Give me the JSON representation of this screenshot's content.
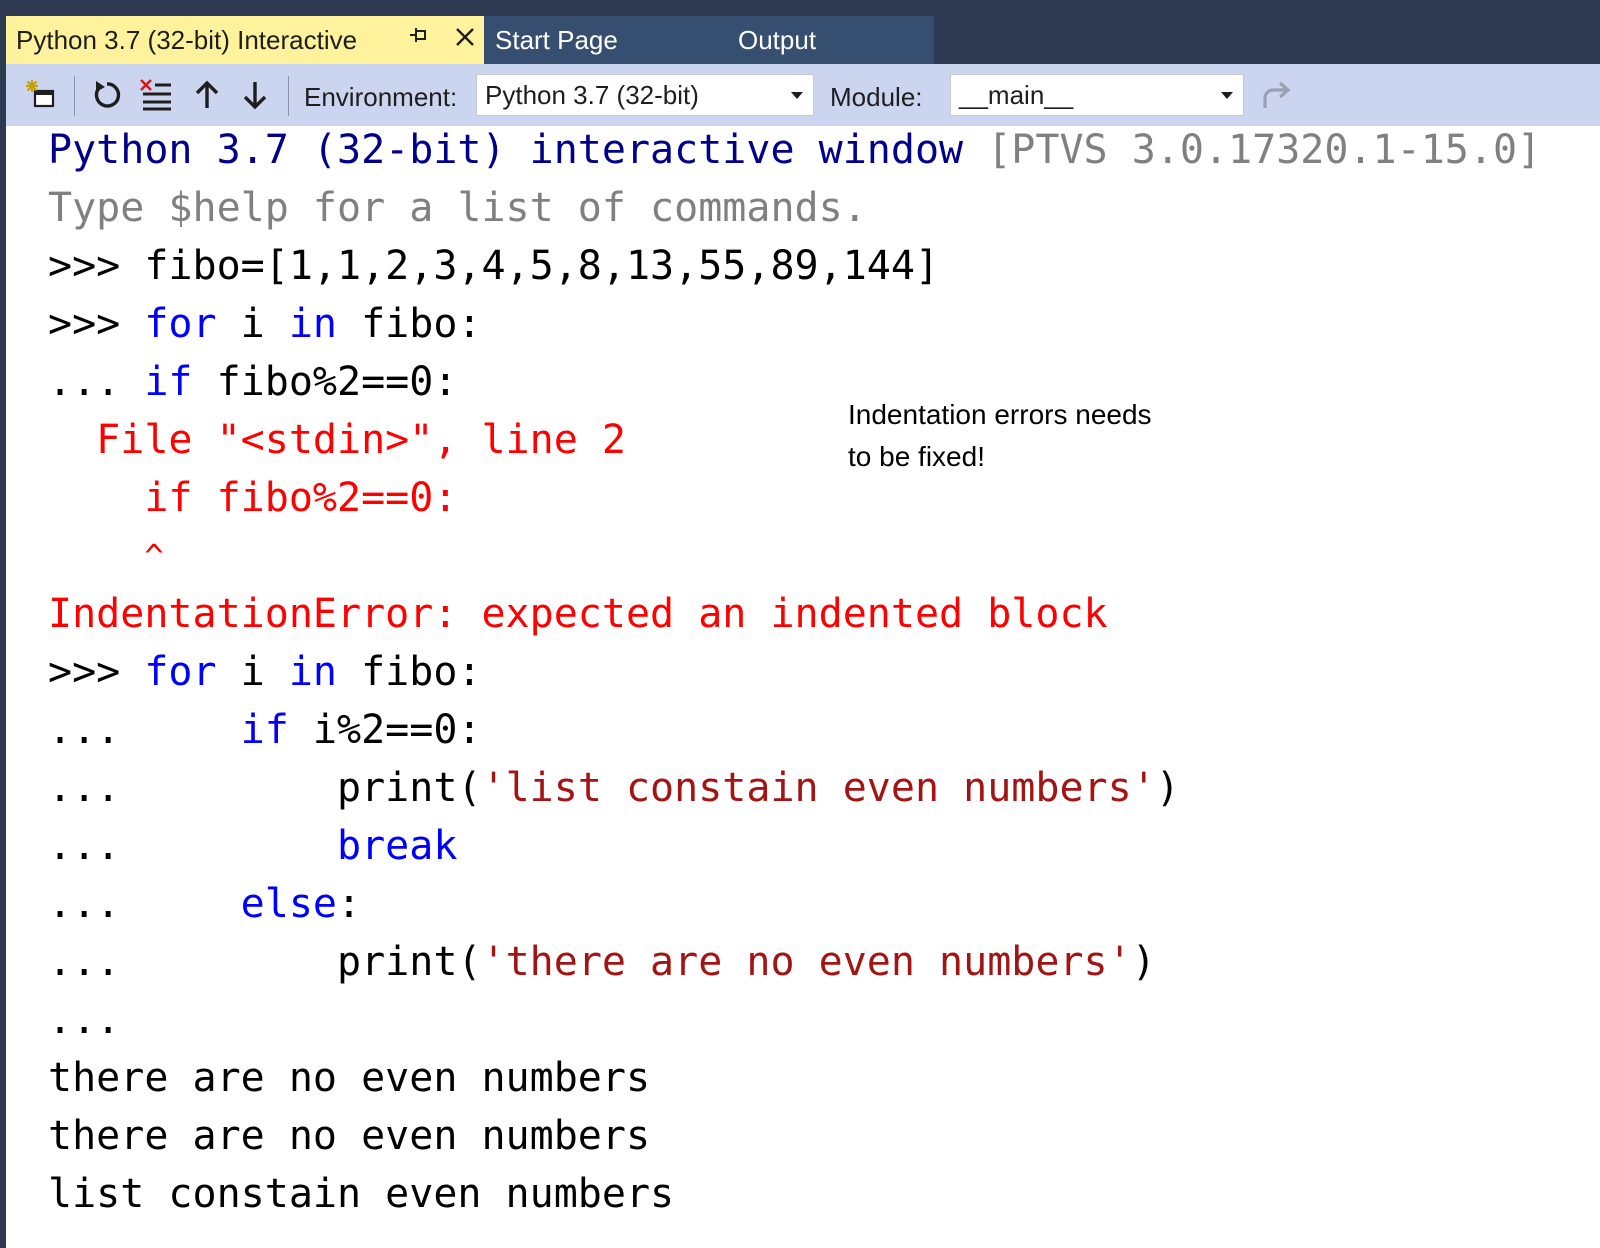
{
  "tabs": [
    {
      "label": "Python 3.7 (32-bit) Interactive",
      "active": true
    },
    {
      "label": "Start Page",
      "active": false
    },
    {
      "label": "Output",
      "active": false
    }
  ],
  "toolbar": {
    "icons": [
      "new-interactive-icon",
      "reset-icon",
      "clear-icon",
      "history-up-icon",
      "history-down-icon",
      "redo-icon"
    ],
    "environment_label": "Environment:",
    "environment_value": "Python 3.7 (32-bit)",
    "module_label": "Module:",
    "module_value": "__main__"
  },
  "console": {
    "banner_main": "Python 3.7 (32-bit) interactive window",
    "banner_version": "[PTVS 3.0.17320.1-15.0]",
    "help_line": "Type $help for a list of commands.",
    "l1_prompt": ">>> ",
    "l1_code": "fibo=[1,1,2,3,4,5,8,13,55,89,144]",
    "l2_prompt": ">>> ",
    "l2_kw1": "for",
    "l2_mid": " i ",
    "l2_kw2": "in",
    "l2_end": " fibo:",
    "l3_prompt": "... ",
    "l3_kw": "if",
    "l3_end": " fibo%2==0:",
    "err_file": "  File \"<stdin>\", line 2",
    "err_code": "    if fibo%2==0:",
    "err_caret": "     ^",
    "err_msg": "IndentationError: expected an indented block",
    "l4_prompt": ">>> ",
    "l4_kw1": "for",
    "l4_mid": " i ",
    "l4_kw2": "in",
    "l4_end": " fibo:",
    "l5_prompt": "...     ",
    "l5_kw": "if",
    "l5_end": " i%2==0:",
    "l6_prompt": "...         ",
    "l6_func": "print(",
    "l6_str": "'list constain even numbers'",
    "l6_end": ")",
    "l7_prompt": "...         ",
    "l7_kw": "break",
    "l8_prompt": "...     ",
    "l8_kw": "else",
    "l8_end": ":",
    "l9_prompt": "...         ",
    "l9_func": "print(",
    "l9_str": "'there are no even numbers'",
    "l9_end": ")",
    "l10_prompt": "...",
    "out1": "there are no even numbers",
    "out2": "there are no even numbers",
    "out3": "list constain even numbers"
  },
  "annotation": {
    "line1": "Indentation errors needs",
    "line2": "to be fixed!"
  },
  "colors": {
    "tab_active_bg": "#fff29d",
    "tab_bar_bg": "#2d3a52",
    "toolbar_bg": "#ccd5f0",
    "keyword": "#0000ff",
    "string": "#a31515",
    "error": "#ff0000",
    "banner": "#00008b",
    "gray": "#808080"
  }
}
